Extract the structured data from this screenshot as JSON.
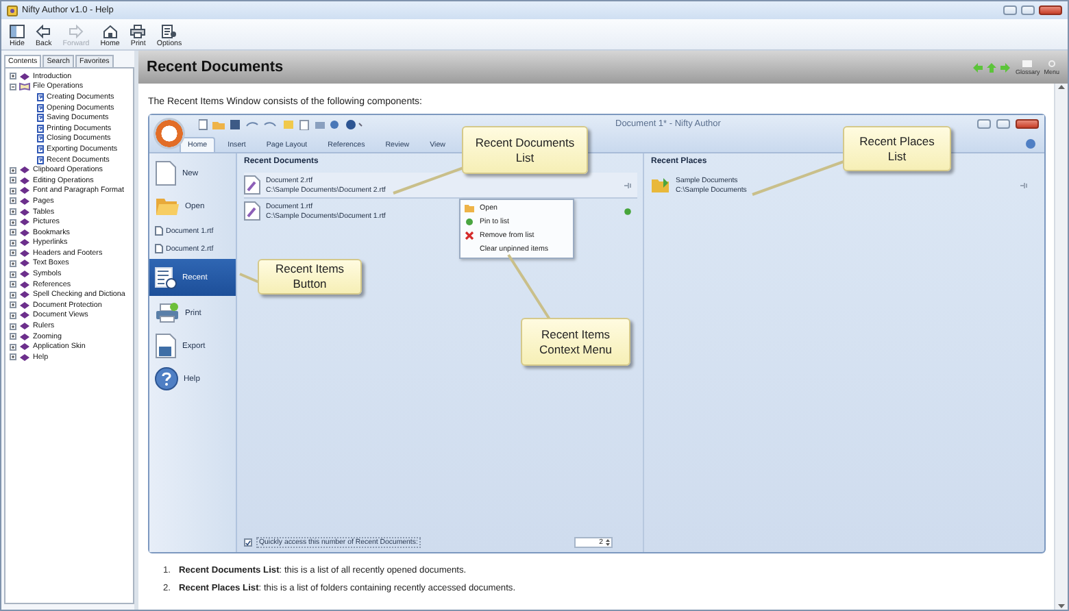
{
  "window": {
    "title": "Nifty Author v1.0 - Help"
  },
  "toolbar": [
    {
      "label": "Hide",
      "kind": "hide",
      "disabled": false
    },
    {
      "label": "Back",
      "kind": "back",
      "disabled": false
    },
    {
      "label": "Forward",
      "kind": "forward",
      "disabled": true
    },
    {
      "label": "Home",
      "kind": "home",
      "disabled": false
    },
    {
      "label": "Print",
      "kind": "print",
      "disabled": false
    },
    {
      "label": "Options",
      "kind": "options",
      "disabled": false
    }
  ],
  "nav_tabs": [
    {
      "label": "Contents",
      "selected": true
    },
    {
      "label": "Search",
      "selected": false
    },
    {
      "label": "Favorites",
      "selected": false
    }
  ],
  "tree": [
    {
      "label": "Introduction",
      "expanded": false
    },
    {
      "label": "File Operations",
      "expanded": true,
      "children": [
        {
          "label": "Creating Documents"
        },
        {
          "label": "Opening Documents"
        },
        {
          "label": "Saving Documents"
        },
        {
          "label": "Printing Documents"
        },
        {
          "label": "Closing Documents"
        },
        {
          "label": "Exporting Documents"
        },
        {
          "label": "Recent Documents"
        }
      ]
    },
    {
      "label": "Clipboard Operations",
      "expanded": false
    },
    {
      "label": "Editing Operations",
      "expanded": false
    },
    {
      "label": "Font and Paragraph Format",
      "expanded": false
    },
    {
      "label": "Pages",
      "expanded": false
    },
    {
      "label": "Tables",
      "expanded": false
    },
    {
      "label": "Pictures",
      "expanded": false
    },
    {
      "label": "Bookmarks",
      "expanded": false
    },
    {
      "label": "Hyperlinks",
      "expanded": false
    },
    {
      "label": "Headers and Footers",
      "expanded": false
    },
    {
      "label": "Text Boxes",
      "expanded": false
    },
    {
      "label": "Symbols",
      "expanded": false
    },
    {
      "label": "References",
      "expanded": false
    },
    {
      "label": "Spell Checking and Dictiona",
      "expanded": false
    },
    {
      "label": "Document Protection",
      "expanded": false
    },
    {
      "label": "Document Views",
      "expanded": false
    },
    {
      "label": "Rulers",
      "expanded": false
    },
    {
      "label": "Zooming",
      "expanded": false
    },
    {
      "label": "Application Skin",
      "expanded": false
    },
    {
      "label": "Help",
      "expanded": false
    }
  ],
  "topic": {
    "title": "Recent Documents",
    "nav": [
      "Glossary",
      "Menu"
    ],
    "intro": "The Recent Items Window consists of the following components:",
    "figure": {
      "app_title": "Document 1* - Nifty Author",
      "ribbon_tabs": [
        {
          "label": "Home",
          "selected": true
        },
        {
          "label": "Insert",
          "selected": false
        },
        {
          "label": "Page Layout",
          "selected": false
        },
        {
          "label": "References",
          "selected": false
        },
        {
          "label": "Review",
          "selected": false
        },
        {
          "label": "View",
          "selected": false
        }
      ],
      "menu": [
        {
          "label": "New",
          "kind": "new",
          "selected": false
        },
        {
          "label": "Open",
          "kind": "open",
          "selected": false
        },
        {
          "label": "Document 1.rtf",
          "kind": "file",
          "selected": false
        },
        {
          "label": "Document 2.rtf",
          "kind": "file",
          "selected": false
        },
        {
          "label": "Recent",
          "kind": "recent",
          "selected": true
        },
        {
          "label": "Print",
          "kind": "print",
          "selected": false
        },
        {
          "label": "Export",
          "kind": "export",
          "selected": false
        },
        {
          "label": "Help",
          "kind": "help",
          "selected": false
        }
      ],
      "recent_documents": {
        "title": "Recent Documents",
        "items": [
          {
            "name": "Document 2.rtf",
            "path": "C:\\Sample Documents\\Document 2.rtf",
            "pinned": false
          },
          {
            "name": "Document 1.rtf",
            "path": "C:\\Sample Documents\\Document 1.rtf",
            "pinned": true
          }
        ]
      },
      "quick_access": {
        "label": "Quickly access this number of Recent Documents:",
        "checked": true,
        "value": "2"
      },
      "recent_places": {
        "title": "Recent Places",
        "items": [
          {
            "name": "Sample Documents",
            "path": "C:\\Sample Documents",
            "pinned": false
          }
        ]
      },
      "context_menu": [
        {
          "label": "Open",
          "kind": "open"
        },
        {
          "label": "Pin to list",
          "kind": "pin"
        },
        {
          "label": "Remove from list",
          "kind": "remove"
        },
        {
          "label": "Clear unpinned items",
          "kind": "plain"
        }
      ],
      "callouts": [
        "Recent Documents List",
        "Recent Places List",
        "Recent Items Button",
        "Recent Items Context Menu"
      ]
    },
    "list": [
      {
        "number": "1.",
        "text": "**Recent Documents List**: this is a list of all recently opened documents."
      },
      {
        "number": "2.",
        "text": "**Recent Places List**: this is a list of folders containing recently accessed documents."
      }
    ]
  }
}
